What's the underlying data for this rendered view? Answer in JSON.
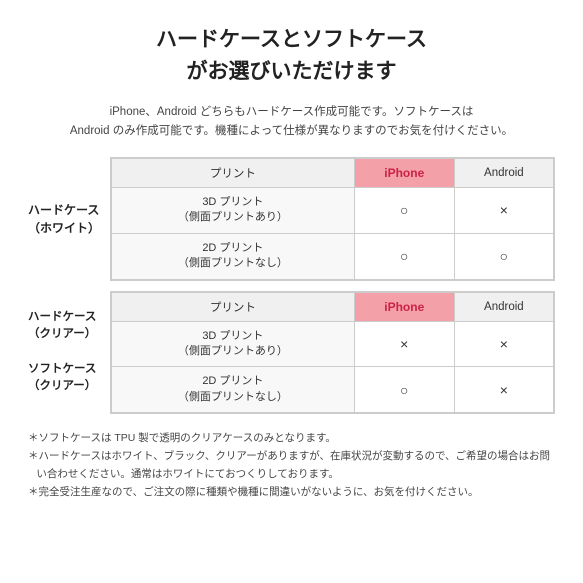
{
  "title_line1": "ハードケースとソフトケース",
  "title_line2": "がお選びいただけます",
  "subtitle": "iPhone、Android どちらもハードケース作成可能です。ソフトケースは\nAndroid のみ作成可能です。機種によって仕様が異なりますのでお気を付けください。",
  "table1": {
    "row_label": "ハードケース\n（ホワイト）",
    "header": [
      "プリント",
      "iPhone",
      "Android"
    ],
    "rows": [
      {
        "label": "3D プリント\n（側面プリントあり）",
        "iphone": "○",
        "android": "×"
      },
      {
        "label": "2D プリント\n（側面プリントなし）",
        "iphone": "○",
        "android": "○"
      }
    ]
  },
  "table2": {
    "row_label": "ハードケース\n（クリアー）\nソフトケース\n（クリアー）",
    "header": [
      "プリント",
      "iPhone",
      "Android"
    ],
    "rows": [
      {
        "label": "3D プリント\n（側面プリントあり）",
        "iphone": "×",
        "android": "×"
      },
      {
        "label": "2D プリント\n（側面プリントなし）",
        "iphone": "○",
        "android": "×"
      }
    ]
  },
  "notes": [
    "＊ソフトケースは TPU 製で透明のクリアケースのみとなります。",
    "＊ハードケースはホワイト、ブラック、クリアーがありますが、在庫状況が変動するので、ご希望の場合はお問い合わせください。通常はホワイトにておつくりしております。",
    "＊完全受注生産なので、ご注文の際に種類や機種に間違いがないように、お気を付けください。"
  ]
}
